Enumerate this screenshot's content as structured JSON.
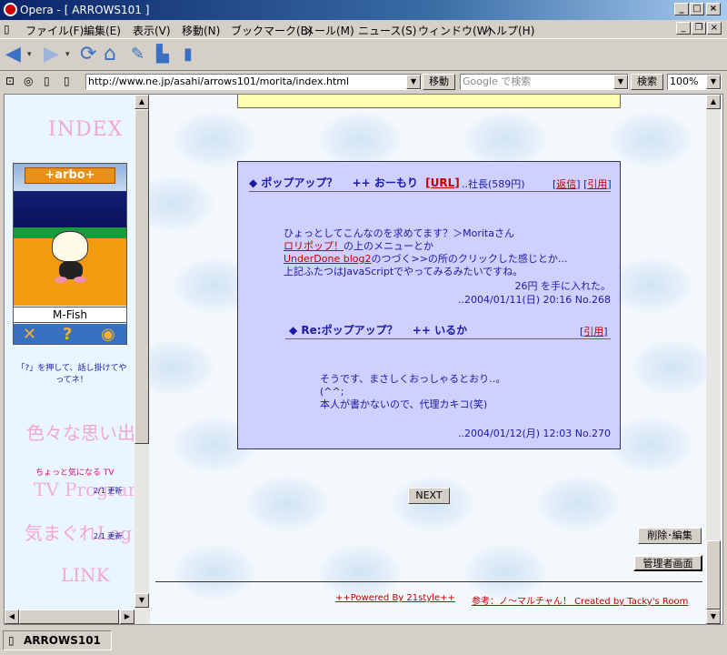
{
  "window": {
    "title": "Opera - [ ARROWS101 ]"
  },
  "menu": [
    "ファイル(F)",
    "編集(E)",
    "表示(V)",
    "移動(N)",
    "ブックマーク(B)",
    "メール(M)",
    "ニュース(S)",
    "ウィンドウ(W)",
    "ヘルプ(H)"
  ],
  "address": {
    "url": "http://www.ne.jp/asahi/arrows101/morita/index.html",
    "go_label": "移動",
    "search_placeholder": "Google で検索",
    "search_label": "検索",
    "zoom": "100%"
  },
  "sidebar": {
    "index": "INDEX",
    "widget": {
      "brand": "+arbo+",
      "name": "M-Fish"
    },
    "hint": "「?」を押して、話し掛けてやってネ！",
    "links": [
      "色々な思い出",
      "ちょっと気になる TV",
      "TV Program",
      "気まぐれLog",
      "LINK"
    ],
    "dates": [
      "2/1 更新",
      "2/1 更新"
    ]
  },
  "post": {
    "title": "ポップアップ？",
    "author": "おーもり",
    "url_label": "[URL]",
    "extra": "..社長(589円)",
    "reply_label": "返信",
    "quote_label": "引用",
    "body": [
      "ひょっとしてこんなのを求めてます？＞Moritaさん"
    ],
    "link1": "ロリポップ！",
    "link1_tail": "の上のメニューとか",
    "link2": "UnderDone blog2",
    "link2_tail": "のつづく>>の所のクリックした感じとか...",
    "body2": "上記ふたつはJavaScriptでやってみるみたいですね。",
    "coins": "26円 を手に入れた。",
    "date": "..2004/01/11(日) 20:16 No.268"
  },
  "reply": {
    "title": "Re:ポップアップ？",
    "author": "いるか",
    "quote_label": "引用",
    "lines": [
      "そうです、まさしくおっしゃるとおり‥。",
      "(^^;",
      "本人が書かないので、代理カキコ(笑)"
    ],
    "date": "..2004/01/12(月) 12:03 No.270"
  },
  "nav": {
    "next": "NEXT",
    "delete_edit": "削除･編集",
    "admin": "管理者画面"
  },
  "footer": {
    "powered": "++Powered By 21style++",
    "ref": "参考：ノ～マルチャん！ Created by Tacky's Room"
  },
  "status": {
    "tab": "ARROWS101"
  }
}
